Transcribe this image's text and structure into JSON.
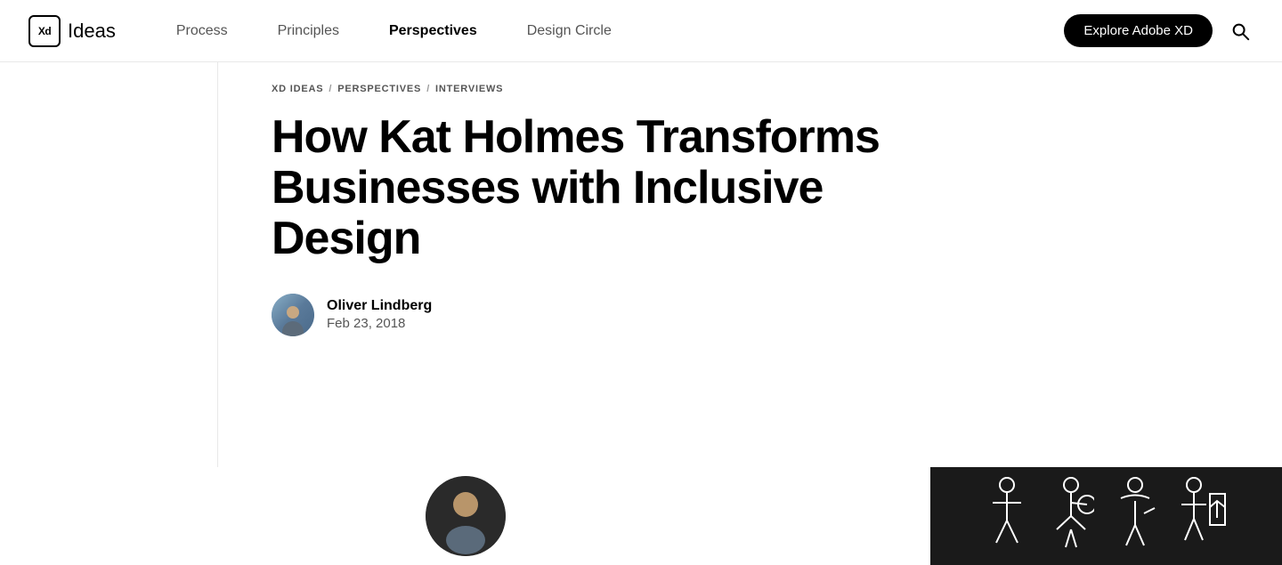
{
  "nav": {
    "logo": {
      "badge": "Xd",
      "brand": "Ideas"
    },
    "links": [
      {
        "id": "process",
        "label": "Process",
        "active": false
      },
      {
        "id": "principles",
        "label": "Principles",
        "active": false
      },
      {
        "id": "perspectives",
        "label": "Perspectives",
        "active": true
      },
      {
        "id": "design-circle",
        "label": "Design Circle",
        "active": false
      }
    ],
    "explore_btn": "Explore Adobe XD"
  },
  "breadcrumb": {
    "items": [
      {
        "id": "xd-ideas",
        "label": "XD IDEAS"
      },
      {
        "id": "perspectives",
        "label": "PERSPECTIVES"
      },
      {
        "id": "interviews",
        "label": "INTERVIEWS"
      }
    ]
  },
  "article": {
    "title": "How Kat Holmes Transforms Businesses with Inclusive Design",
    "author": {
      "name": "Oliver Lindberg",
      "date": "Feb 23, 2018"
    }
  },
  "colors": {
    "accent": "#000000",
    "nav_bg": "#ffffff",
    "dark_panel": "#1a1a1a"
  }
}
